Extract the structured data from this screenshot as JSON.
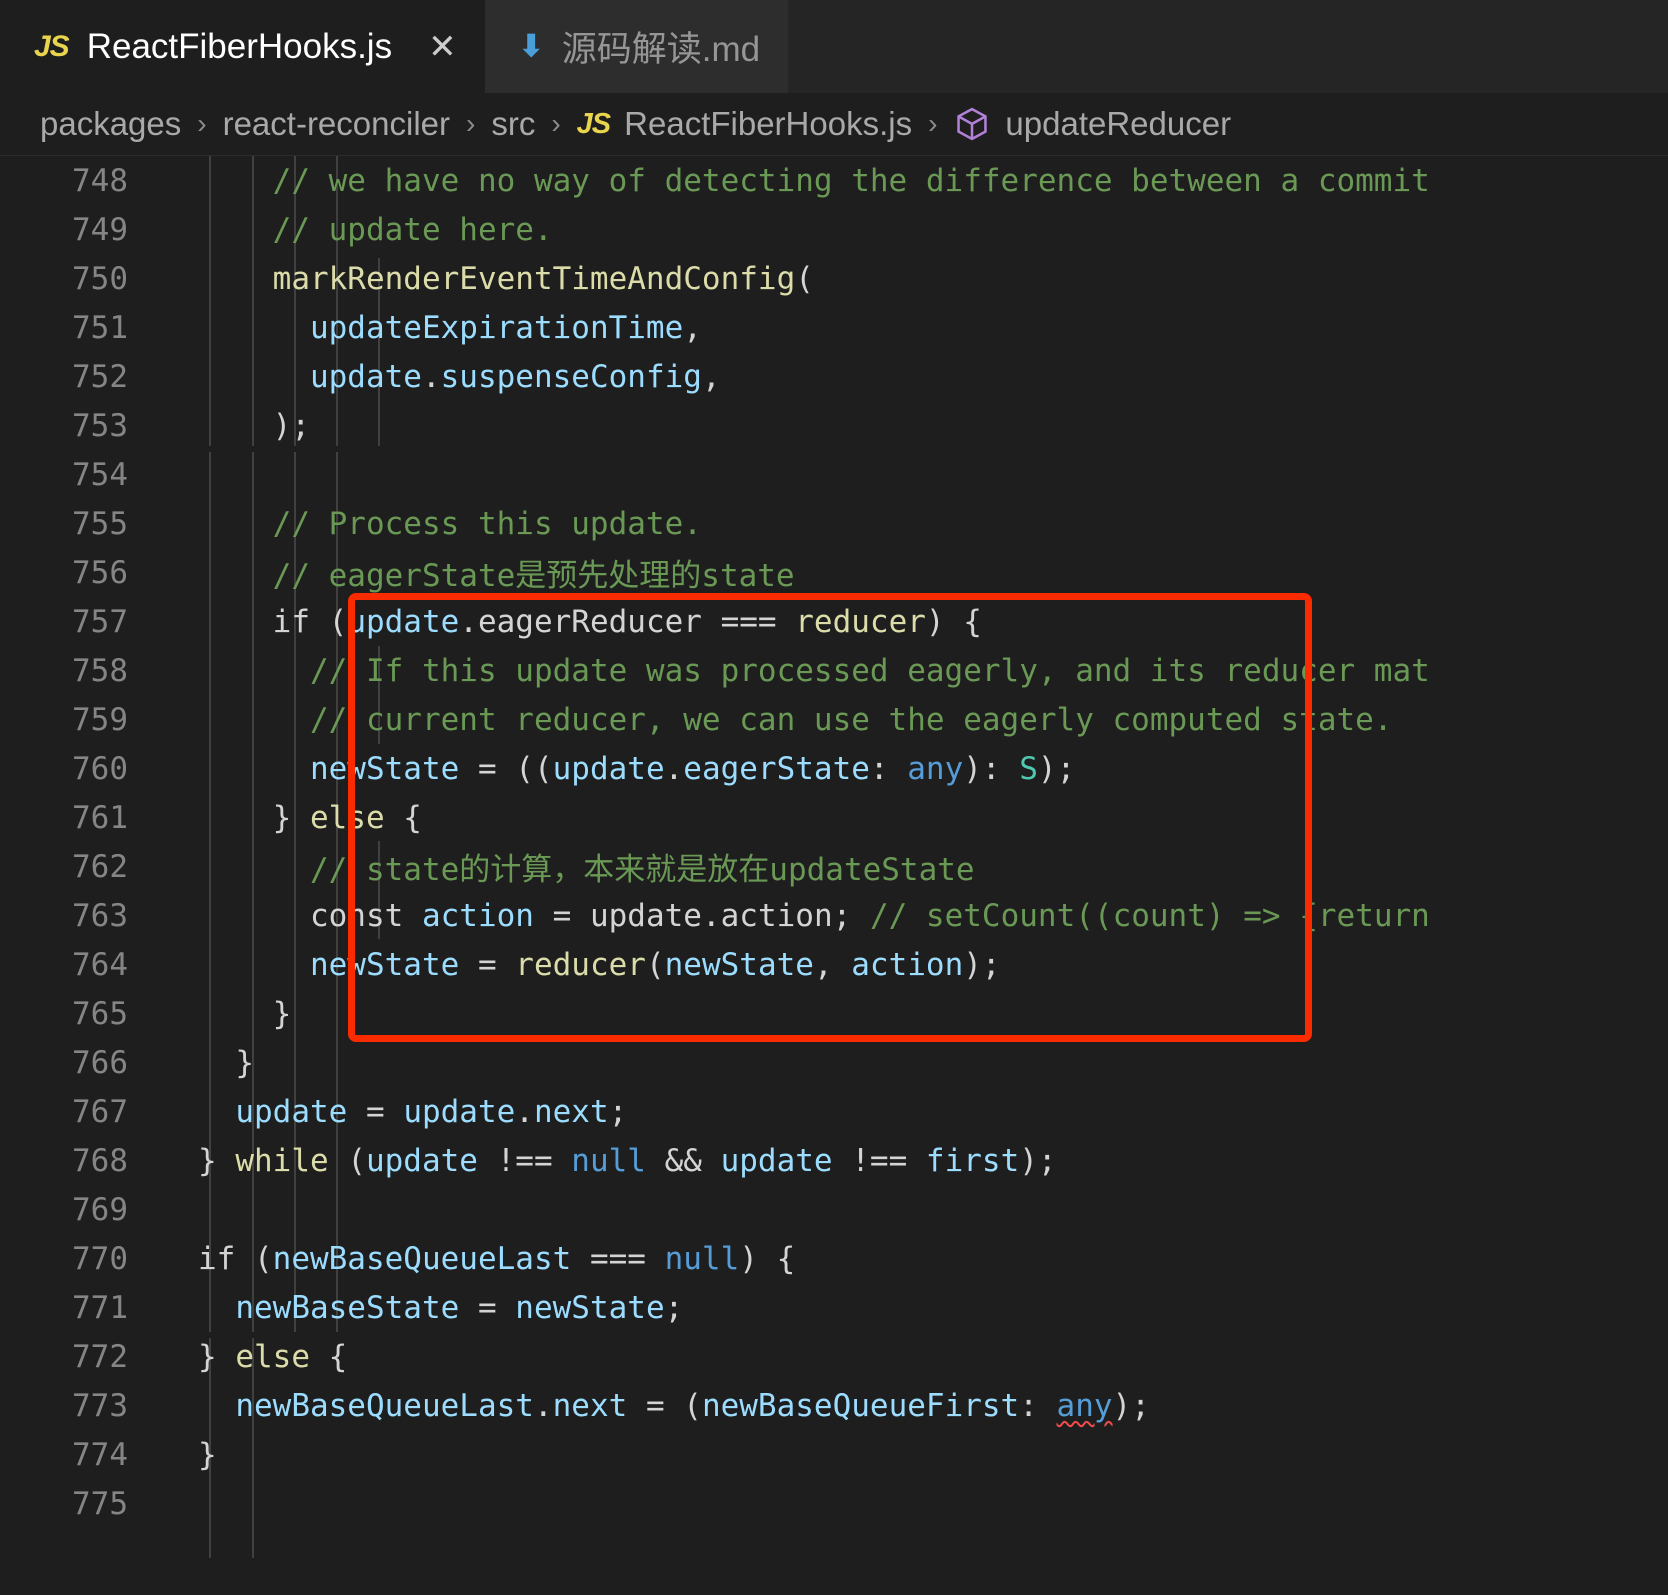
{
  "tabs": [
    {
      "label": "ReactFiberHooks.js",
      "icon": "js-file-icon",
      "icon_text": "JS",
      "active": true,
      "close_label": "✕"
    },
    {
      "label": "源码解读.md",
      "icon": "markdown-file-icon",
      "icon_text": "⬇",
      "active": false,
      "close_label": ""
    }
  ],
  "breadcrumb": {
    "items": [
      {
        "label": "packages",
        "icon": ""
      },
      {
        "label": "react-reconciler",
        "icon": ""
      },
      {
        "label": "src",
        "icon": ""
      },
      {
        "label": "ReactFiberHooks.js",
        "icon": "js-file-icon",
        "icon_text": "JS"
      },
      {
        "label": "updateReducer",
        "icon": "symbol-method-cube-icon"
      }
    ],
    "separator": "›"
  },
  "colors": {
    "editor_background": "#1e1e1e",
    "tab_active_background": "#1e1e1e",
    "tab_inactive_background": "#2d2d2d",
    "tabbar_background": "#252526",
    "annotation_red": "#fb2b00",
    "comment_green": "#6a9955",
    "variable_blue": "#9cdcfe",
    "function_yellow": "#dcdcaa",
    "keyword_purple": "#c586c0",
    "type_teal": "#4ec9b0",
    "linenumber_gray": "#858585",
    "js_icon_yellow": "#e8d44d",
    "md_icon_blue": "#4a9fd8",
    "symbol_cube_purple": "#b180d7"
  },
  "editor": {
    "first_visible_line": 748,
    "annotation": {
      "type": "red-rectangle-highlight",
      "from_line": 757,
      "to_line": 765
    },
    "lines": [
      {
        "n": 748,
        "indent": 0,
        "tokens": [
          {
            "t": "    ",
            "c": "c-txt"
          },
          {
            "t": "// we have no way of detecting the difference between a commit",
            "c": "c-com"
          }
        ]
      },
      {
        "n": 749,
        "indent": 0,
        "tokens": [
          {
            "t": "    ",
            "c": "c-txt"
          },
          {
            "t": "// update here.",
            "c": "c-com"
          }
        ]
      },
      {
        "n": 750,
        "indent": 0,
        "tokens": [
          {
            "t": "    ",
            "c": "c-txt"
          },
          {
            "t": "markRenderEventTimeAndConfig",
            "c": "c-fn"
          },
          {
            "t": "(",
            "c": "c-txt"
          }
        ]
      },
      {
        "n": 751,
        "indent": 0,
        "tokens": [
          {
            "t": "      ",
            "c": "c-txt"
          },
          {
            "t": "updateExpirationTime",
            "c": "c-var"
          },
          {
            "t": ",",
            "c": "c-txt"
          }
        ]
      },
      {
        "n": 752,
        "indent": 0,
        "tokens": [
          {
            "t": "      ",
            "c": "c-txt"
          },
          {
            "t": "update",
            "c": "c-var"
          },
          {
            "t": ".",
            "c": "c-txt"
          },
          {
            "t": "suspenseConfig",
            "c": "c-var"
          },
          {
            "t": ",",
            "c": "c-txt"
          }
        ]
      },
      {
        "n": 753,
        "indent": 0,
        "tokens": [
          {
            "t": "    );",
            "c": "c-txt"
          }
        ]
      },
      {
        "n": 754,
        "indent": 0,
        "tokens": []
      },
      {
        "n": 755,
        "indent": 0,
        "tokens": [
          {
            "t": "    ",
            "c": "c-txt"
          },
          {
            "t": "// Process this update.",
            "c": "c-com"
          }
        ]
      },
      {
        "n": 756,
        "indent": 0,
        "tokens": [
          {
            "t": "    ",
            "c": "c-txt"
          },
          {
            "t": "// eagerState是预先处理的state",
            "c": "c-com"
          }
        ]
      },
      {
        "n": 757,
        "indent": 0,
        "tokens": [
          {
            "t": "    ",
            "c": "c-txt"
          },
          {
            "t": "if",
            "c": "c-txt"
          },
          {
            "t": " (",
            "c": "c-txt"
          },
          {
            "t": "update",
            "c": "c-var"
          },
          {
            "t": ".",
            "c": "c-txt"
          },
          {
            "t": "eagerReducer",
            "c": "c-txt"
          },
          {
            "t": " === ",
            "c": "c-txt"
          },
          {
            "t": "reducer",
            "c": "c-fn"
          },
          {
            "t": ") {",
            "c": "c-txt"
          }
        ]
      },
      {
        "n": 758,
        "indent": 0,
        "tokens": [
          {
            "t": "      ",
            "c": "c-txt"
          },
          {
            "t": "// If this update was processed eagerly, and its reducer mat",
            "c": "c-com"
          }
        ]
      },
      {
        "n": 759,
        "indent": 0,
        "tokens": [
          {
            "t": "      ",
            "c": "c-txt"
          },
          {
            "t": "// current reducer, we can use the eagerly computed state.",
            "c": "c-com"
          }
        ]
      },
      {
        "n": 760,
        "indent": 0,
        "tokens": [
          {
            "t": "      ",
            "c": "c-txt"
          },
          {
            "t": "newState",
            "c": "c-var"
          },
          {
            "t": " = ((",
            "c": "c-txt"
          },
          {
            "t": "update",
            "c": "c-var"
          },
          {
            "t": ".",
            "c": "c-txt"
          },
          {
            "t": "eagerState",
            "c": "c-var"
          },
          {
            "t": ": ",
            "c": "c-txt"
          },
          {
            "t": "any",
            "c": "c-blue"
          },
          {
            "t": "): ",
            "c": "c-txt"
          },
          {
            "t": "S",
            "c": "c-type"
          },
          {
            "t": ");",
            "c": "c-txt"
          }
        ]
      },
      {
        "n": 761,
        "indent": 0,
        "tokens": [
          {
            "t": "    } ",
            "c": "c-txt"
          },
          {
            "t": "else",
            "c": "c-fn"
          },
          {
            "t": " {",
            "c": "c-txt"
          }
        ]
      },
      {
        "n": 762,
        "indent": 0,
        "tokens": [
          {
            "t": "      ",
            "c": "c-txt"
          },
          {
            "t": "// state的计算，本来就是放在updateState",
            "c": "c-com"
          }
        ]
      },
      {
        "n": 763,
        "indent": 0,
        "tokens": [
          {
            "t": "      ",
            "c": "c-txt"
          },
          {
            "t": "const",
            "c": "c-txt"
          },
          {
            "t": " ",
            "c": "c-txt"
          },
          {
            "t": "action",
            "c": "c-var"
          },
          {
            "t": " = ",
            "c": "c-txt"
          },
          {
            "t": "update",
            "c": "c-txt"
          },
          {
            "t": ".",
            "c": "c-txt"
          },
          {
            "t": "action",
            "c": "c-txt"
          },
          {
            "t": "; ",
            "c": "c-txt"
          },
          {
            "t": "// setCount((count) => {return",
            "c": "c-com"
          }
        ]
      },
      {
        "n": 764,
        "indent": 0,
        "tokens": [
          {
            "t": "      ",
            "c": "c-txt"
          },
          {
            "t": "newState",
            "c": "c-var"
          },
          {
            "t": " = ",
            "c": "c-txt"
          },
          {
            "t": "reducer",
            "c": "c-fn"
          },
          {
            "t": "(",
            "c": "c-txt"
          },
          {
            "t": "newState",
            "c": "c-var"
          },
          {
            "t": ", ",
            "c": "c-txt"
          },
          {
            "t": "action",
            "c": "c-var"
          },
          {
            "t": ");",
            "c": "c-txt"
          }
        ]
      },
      {
        "n": 765,
        "indent": 0,
        "tokens": [
          {
            "t": "    }",
            "c": "c-txt"
          }
        ]
      },
      {
        "n": 766,
        "indent": 0,
        "tokens": [
          {
            "t": "  }",
            "c": "c-txt"
          }
        ]
      },
      {
        "n": 767,
        "indent": 0,
        "tokens": [
          {
            "t": "  ",
            "c": "c-txt"
          },
          {
            "t": "update",
            "c": "c-var"
          },
          {
            "t": " = ",
            "c": "c-txt"
          },
          {
            "t": "update",
            "c": "c-var"
          },
          {
            "t": ".",
            "c": "c-txt"
          },
          {
            "t": "next",
            "c": "c-var"
          },
          {
            "t": ";",
            "c": "c-txt"
          }
        ]
      },
      {
        "n": 768,
        "indent": 0,
        "tokens": [
          {
            "t": "} ",
            "c": "c-txt"
          },
          {
            "t": "while",
            "c": "c-fn"
          },
          {
            "t": " (",
            "c": "c-txt"
          },
          {
            "t": "update",
            "c": "c-var"
          },
          {
            "t": " !== ",
            "c": "c-txt"
          },
          {
            "t": "null",
            "c": "c-blue"
          },
          {
            "t": " && ",
            "c": "c-txt"
          },
          {
            "t": "update",
            "c": "c-var"
          },
          {
            "t": " !== ",
            "c": "c-txt"
          },
          {
            "t": "first",
            "c": "c-var"
          },
          {
            "t": ");",
            "c": "c-txt"
          }
        ]
      },
      {
        "n": 769,
        "indent": 0,
        "tokens": []
      },
      {
        "n": 770,
        "indent": 0,
        "tokens": [
          {
            "t": "if",
            "c": "c-txt"
          },
          {
            "t": " (",
            "c": "c-txt"
          },
          {
            "t": "newBaseQueueLast",
            "c": "c-var"
          },
          {
            "t": " === ",
            "c": "c-txt"
          },
          {
            "t": "null",
            "c": "c-blue"
          },
          {
            "t": ") {",
            "c": "c-txt"
          }
        ]
      },
      {
        "n": 771,
        "indent": 0,
        "tokens": [
          {
            "t": "  ",
            "c": "c-txt"
          },
          {
            "t": "newBaseState",
            "c": "c-var"
          },
          {
            "t": " = ",
            "c": "c-txt"
          },
          {
            "t": "newState",
            "c": "c-var"
          },
          {
            "t": ";",
            "c": "c-txt"
          }
        ]
      },
      {
        "n": 772,
        "indent": 0,
        "tokens": [
          {
            "t": "} ",
            "c": "c-txt"
          },
          {
            "t": "else",
            "c": "c-fn"
          },
          {
            "t": " {",
            "c": "c-txt"
          }
        ]
      },
      {
        "n": 773,
        "indent": 0,
        "tokens": [
          {
            "t": "  ",
            "c": "c-txt"
          },
          {
            "t": "newBaseQueueLast",
            "c": "c-var"
          },
          {
            "t": ".",
            "c": "c-txt"
          },
          {
            "t": "next",
            "c": "c-var"
          },
          {
            "t": " = (",
            "c": "c-txt"
          },
          {
            "t": "newBaseQueueFirst",
            "c": "c-var"
          },
          {
            "t": ": ",
            "c": "c-txt"
          },
          {
            "t": "any",
            "c": "c-blue squiggle"
          },
          {
            "t": ");",
            "c": "c-txt"
          }
        ]
      },
      {
        "n": 774,
        "indent": 0,
        "tokens": [
          {
            "t": "}",
            "c": "c-txt"
          }
        ]
      },
      {
        "n": 775,
        "indent": 0,
        "tokens": []
      }
    ]
  }
}
